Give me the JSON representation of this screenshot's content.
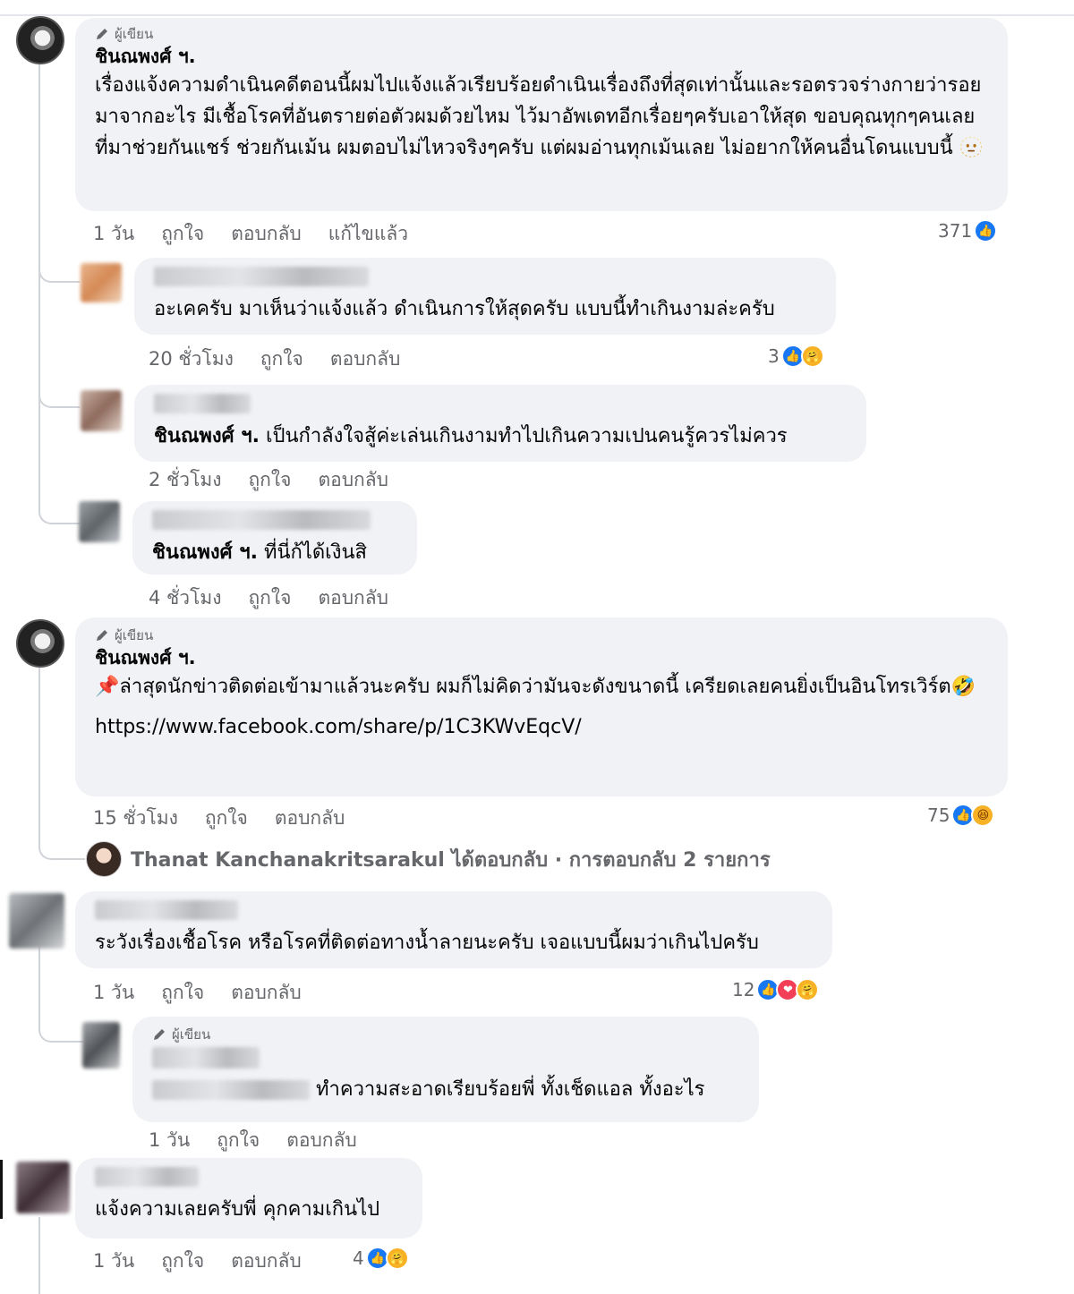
{
  "author_badge_label": "ผู้เขียน",
  "comments": [
    {
      "author": "ชินณพงศ์ ฯ.",
      "text": "เรื่องแจ้งความดำเนินคดีตอนนี้ผมไปแจ้งแล้วเรียบร้อยดำเนินเรื่องถึงที่สุดเท่านั้นและรอตรวจร่างกายว่ารอยมาจากอะไร มีเชื้อโรคที่อันตรายต่อตัวผมด้วยไหม ไว้มาอัพเดทอีกเรื่อยๆครับเอาให้สุด ขอบคุณทุกๆคนเลยที่มาช่วยกันแชร์ ช่วยกันเม้น ผมตอบไม่ไหวจริงๆครับ แต่ผมอ่านทุกเม้นเลย ไม่อยากให้คนอื่นโดนแบบนี้",
      "time": "1 วัน",
      "like": "ถูกใจ",
      "reply": "ตอบกลับ",
      "edited": "แก้ไขแล้ว",
      "reaction_count": "371"
    },
    {
      "text": "อะเคครับ มาเห็นว่าแจ้งแล้ว ดำเนินการให้สุดครับ แบบนี้ทำเกินงามล่ะครับ",
      "time": "20 ชั่วโมง",
      "like": "ถูกใจ",
      "reply": "ตอบกลับ",
      "reaction_count": "3"
    },
    {
      "mention": "ชินณพงศ์ ฯ.",
      "text": "เป็นกำลังใจสู้ค่ะเล่นเกินงามทำไปเกินความเปนคนรู้ควรไม่ควร",
      "time": "2 ชั่วโมง",
      "like": "ถูกใจ",
      "reply": "ตอบกลับ"
    },
    {
      "mention": "ชินณพงศ์ ฯ.",
      "text": "ที่นี่ก้ได้เงินสิ",
      "time": "4 ชั่วโมง",
      "like": "ถูกใจ",
      "reply": "ตอบกลับ"
    },
    {
      "author": "ชินณพงศ์ ฯ.",
      "text": "ล่าสุดนักข่าวติดต่อเข้ามาแล้วนะครับ ผมก็ไม่คิดว่ามันจะดังขนาดนี้ เครียดเลยคนยิ่งเป็นอินโทรเวิร์ต",
      "link": "https://www.facebook.com/share/p/1C3KWvEqcV/",
      "time": "15 ชั่วโมง",
      "like": "ถูกใจ",
      "reply": "ตอบกลับ",
      "reaction_count": "75"
    },
    {
      "replies_summary": "Thanat Kanchanakritsarakul ได้ตอบกลับ · การตอบกลับ 2 รายการ"
    },
    {
      "text": "ระวังเรื่องเชื้อโรค หรือโรคที่ติดต่อทางน้ำลายนะครับ เจอแบบนี้ผมว่าเกินไปครับ",
      "time": "1 วัน",
      "like": "ถูกใจ",
      "reply": "ตอบกลับ",
      "reaction_count": "12"
    },
    {
      "text": "ทำความสะอาดเรียบร้อยพี่ ทั้งเช็ดแอล ทั้งอะไร",
      "time": "1 วัน",
      "like": "ถูกใจ",
      "reply": "ตอบกลับ"
    },
    {
      "text": "แจ้งความเลยครับพี่ คุกคามเกินไป",
      "time": "1 วัน",
      "like": "ถูกใจ",
      "reply": "ตอบกลับ",
      "reaction_count": "4"
    }
  ],
  "icons": {
    "like": "like-reaction-icon",
    "care": "care-reaction-icon",
    "haha": "haha-reaction-icon",
    "love": "love-reaction-icon",
    "pen": "pen-icon",
    "pin": "pushpin-icon"
  },
  "colors": {
    "like_blue": "#1877f2",
    "bubble_gray": "#f0f2f5",
    "meta_gray": "#65676b"
  }
}
